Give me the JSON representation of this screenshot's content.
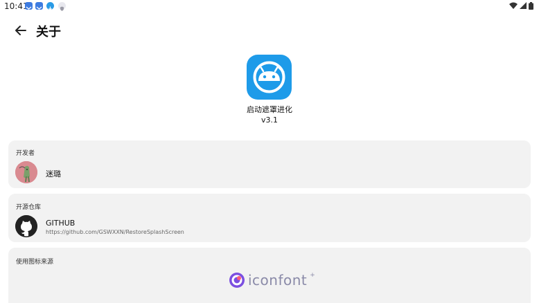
{
  "status": {
    "time": "10:41",
    "notif_icons": [
      "mail-icon",
      "mail-icon",
      "download-icon",
      "shield-icon"
    ],
    "colors": {
      "mail": "#3d7be0",
      "download": "#2a9be6",
      "shield": "#9a9aa6"
    }
  },
  "appbar": {
    "title": "关于"
  },
  "app": {
    "name": "启动遮罩进化",
    "version": "v3.1",
    "icon_color": "#1e9be9"
  },
  "sections": {
    "developer": {
      "label": "开发者",
      "name": "迷璐"
    },
    "repo": {
      "label": "开源仓库",
      "title": "GITHUB",
      "url": "https://github.com/GSWXXN/RestoreSplashScreen"
    },
    "icons": {
      "label": "使用图标来源",
      "brand": "iconfont",
      "brand_mark": "+"
    }
  }
}
